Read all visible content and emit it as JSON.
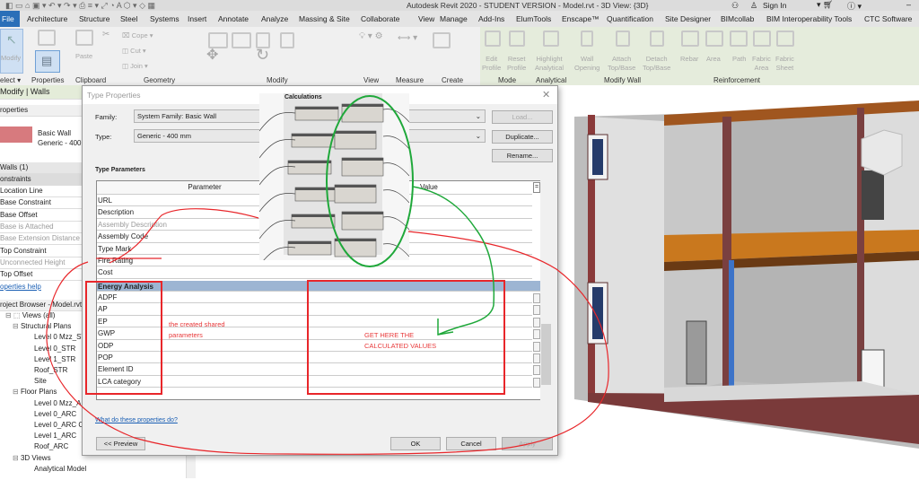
{
  "window": {
    "title": "Autodesk Revit 2020 - STUDENT VERSION - Model.rvt - 3D View: {3D}",
    "sign_in": "Sign In"
  },
  "tabs": [
    "File",
    "Architecture",
    "Structure",
    "Steel",
    "Systems",
    "Insert",
    "Annotate",
    "Analyze",
    "Massing & Site",
    "Collaborate",
    "View",
    "Manage",
    "Add-Ins",
    "ElumTools",
    "Enscape™",
    "Quantification",
    "Site Designer",
    "BIMcollab",
    "BIM Interoperability Tools",
    "CTC Software"
  ],
  "ribbon": {
    "buttons": {
      "modify": "Modify",
      "paste": "Paste",
      "cope": "Cope",
      "cut": "Cut",
      "join": "Join",
      "edit_profile": [
        "Edit",
        "Profile"
      ],
      "reset_profile": [
        "Reset",
        "Profile"
      ],
      "highlight": [
        "Highlight",
        "Analytical"
      ],
      "wall_opening": [
        "Wall",
        "Opening"
      ],
      "attach": [
        "Attach",
        "Top/Base"
      ],
      "detach": [
        "Detach",
        "Top/Base"
      ],
      "rebar": "Rebar",
      "area": "Area",
      "path": "Path",
      "fabric_area": [
        "Fabric",
        "Area"
      ],
      "fabric_sheet": [
        "Fabric",
        "Sheet"
      ]
    },
    "panels": [
      "elect ▾",
      "Properties",
      "Clipboard",
      "Geometry",
      "Modify",
      "View",
      "Measure",
      "Create",
      "Mode",
      "Analytical",
      "Modify Wall",
      "Reinforcement"
    ]
  },
  "left": {
    "context": "Modify | Walls",
    "properties_title": "roperties",
    "type_name": "Basic Wall",
    "type_sub": "Generic - 400",
    "selection": "Walls (1)",
    "group": "onstraints",
    "rows": [
      {
        "t": "Location Line",
        "g": false
      },
      {
        "t": "Base Constraint",
        "g": false
      },
      {
        "t": "Base Offset",
        "g": false
      },
      {
        "t": "Base is Attached",
        "g": true
      },
      {
        "t": "Base Extension Distance",
        "g": true
      },
      {
        "t": "Top Constraint",
        "g": false
      },
      {
        "t": "Unconnected Height",
        "g": true
      },
      {
        "t": "Top Offset",
        "g": false
      }
    ],
    "help": "operties help",
    "browser_title": "roject Browser - Model.rvt",
    "tree": [
      {
        "t": "Views (all)",
        "l": 0
      },
      {
        "t": "Structural Plans",
        "l": 1
      },
      {
        "t": "Level 0 Mzz_ST",
        "l": 2
      },
      {
        "t": "Level 0_STR",
        "l": 2
      },
      {
        "t": "Level 1_STR",
        "l": 2
      },
      {
        "t": "Roof_STR",
        "l": 2
      },
      {
        "t": "Site",
        "l": 2
      },
      {
        "t": "Floor Plans",
        "l": 1
      },
      {
        "t": "Level 0 Mzz_A",
        "l": 2
      },
      {
        "t": "Level 0_ARC",
        "l": 2
      },
      {
        "t": "Level 0_ARC C",
        "l": 2
      },
      {
        "t": "Level 1_ARC",
        "l": 2
      },
      {
        "t": "Roof_ARC",
        "l": 2
      },
      {
        "t": "3D Views",
        "l": 1
      },
      {
        "t": "Analytical Model",
        "l": 2
      }
    ]
  },
  "dialog": {
    "title": "Type Properties",
    "family_label": "Family:",
    "family_value": "System Family: Basic Wall",
    "type_label": "Type:",
    "type_value": "Generic - 400 mm",
    "load": "Load...",
    "duplicate": "Duplicate...",
    "rename": "Rename...",
    "type_parameters": "Type Parameters",
    "col_parameter": "Parameter",
    "col_value": "Value",
    "rows": [
      {
        "t": "URL",
        "g": false
      },
      {
        "t": "Description",
        "g": false
      },
      {
        "t": "Assembly Description",
        "g": true
      },
      {
        "t": "Assembly Code",
        "g": false
      },
      {
        "t": "Type Mark",
        "g": false
      },
      {
        "t": "Fire Rating",
        "g": false
      },
      {
        "t": "Cost",
        "g": false
      }
    ],
    "group": "Energy Analysis",
    "energy_rows": [
      "ADPF",
      "AP",
      "EP",
      "GWP",
      "ODP",
      "POP",
      "Element ID",
      "LCA category"
    ],
    "help_link": "What do these properties do?",
    "preview": "<< Preview",
    "ok": "OK",
    "cancel": "Cancel",
    "apply": "Apply"
  },
  "dynamo": {
    "title": "Calculations"
  },
  "annotations": {
    "shared": [
      "the created shared",
      "parameters"
    ],
    "values": [
      "GET HERE THE",
      "CALCULATED VALUES"
    ],
    "colors": {
      "red": "#e8262a",
      "green": "#1fa83a"
    }
  }
}
